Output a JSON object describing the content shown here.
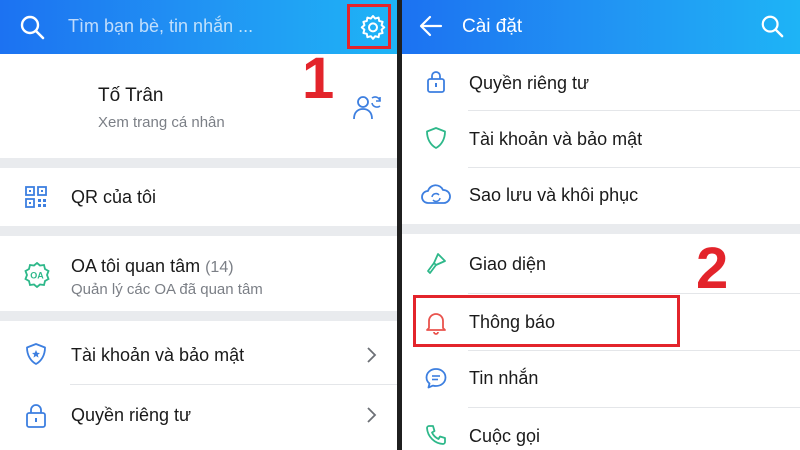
{
  "left": {
    "search": {
      "placeholder": "Tìm bạn bè, tin nhắn ..."
    },
    "profile": {
      "name": "Tố Trân",
      "subtitle": "Xem trang cá nhân"
    },
    "items": [
      {
        "label": "QR của tôi",
        "icon": "qr-code-icon"
      },
      {
        "label": "OA tôi quan tâm",
        "count": "(14)",
        "subtitle": "Quản lý các OA đã quan tâm",
        "icon": "oa-badge-icon"
      },
      {
        "label": "Tài khoản và bảo mật",
        "icon": "shield-icon"
      },
      {
        "label": "Quyền riêng tư",
        "icon": "lock-icon"
      }
    ]
  },
  "right": {
    "title": "Cài đặt",
    "items": [
      {
        "label": "Quyền riêng tư",
        "icon": "lock-icon"
      },
      {
        "label": "Tài khoản và bảo mật",
        "icon": "shield-icon"
      },
      {
        "label": "Sao lưu và khôi phục",
        "icon": "cloud-sync-icon"
      },
      {
        "label": "Giao diện",
        "icon": "paint-brush-icon"
      },
      {
        "label": "Thông báo",
        "icon": "bell-icon"
      },
      {
        "label": "Tin nhắn",
        "icon": "chat-bubble-icon"
      },
      {
        "label": "Cuộc gọi",
        "icon": "phone-icon"
      }
    ]
  },
  "callouts": {
    "step1": "1",
    "step2": "2"
  },
  "colors": {
    "accent": "#2196f3",
    "callout": "#e3242b",
    "icon_blue": "#3d7fe0",
    "icon_green": "#2eb88a",
    "icon_red": "#e9534d"
  }
}
